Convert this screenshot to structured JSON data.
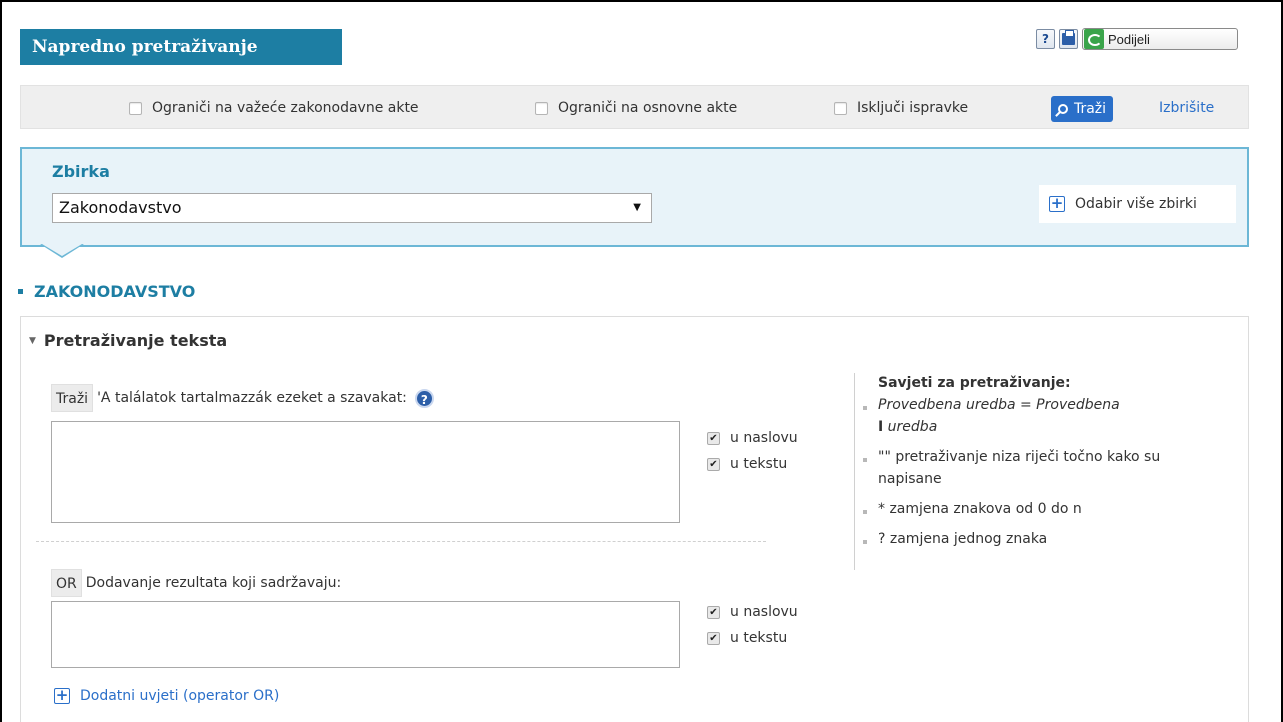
{
  "header": {
    "title": "Napredno pretraživanje",
    "help_icon_label": "?",
    "share_label": "Podijeli"
  },
  "filters": {
    "valid_acts": "Ograniči na važeće zakonodavne akte",
    "basic_acts": "Ograniči na osnovne akte",
    "exclude_corrections": "Isključi ispravke",
    "search_button": "Traži",
    "clear_link": "Izbrišite"
  },
  "collection": {
    "label": "Zbirka",
    "selected": "Zakonodavstvo",
    "more_button": "Odabir više zbirki"
  },
  "section": {
    "title": "ZAKONODAVSTVO"
  },
  "text_search": {
    "heading": "Pretraživanje teksta",
    "search_tag": "Traži",
    "search_prompt": "'A találatok tartalmazzák ezeket a szavakat:",
    "help_label": "?",
    "or_tag": "OR",
    "or_prompt": "Dodavanje rezultata koji sadržavaju:",
    "in_title": "u naslovu",
    "in_text": "u tekstu",
    "add_conditions": "Dodatni uvjeti (operator OR)"
  },
  "tips": {
    "title": "Savjeti za pretraživanje",
    "colon": ":",
    "items": [
      {
        "a": "Provedbena uredba = Provedbena",
        "b": "uredba",
        "mark": "I"
      },
      {
        "text": "\"\" pretraživanje niza riječi točno kako su napisane"
      },
      {
        "text": "* zamjena znakova od 0 do n"
      },
      {
        "text": "? zamjena jednog znaka"
      }
    ]
  }
}
